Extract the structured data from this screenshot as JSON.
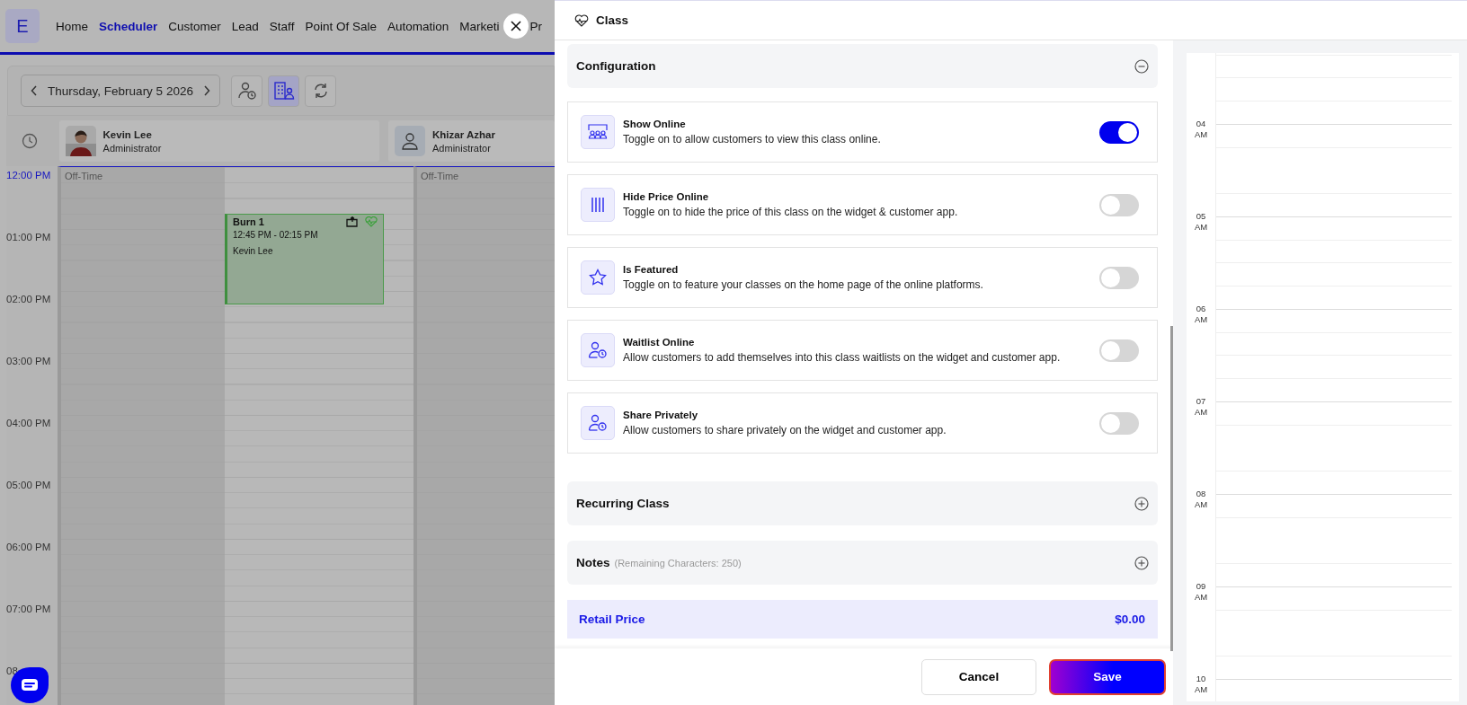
{
  "nav": {
    "logo": "E",
    "items": [
      {
        "label": "Home",
        "selected": false
      },
      {
        "label": "Scheduler",
        "selected": true
      },
      {
        "label": "Customer",
        "selected": false
      },
      {
        "label": "Lead",
        "selected": false
      },
      {
        "label": "Staff",
        "selected": false
      },
      {
        "label": "Point Of Sale",
        "selected": false
      },
      {
        "label": "Automation",
        "selected": false
      },
      {
        "label": "Marketi",
        "selected": false
      },
      {
        "label": "Pr",
        "selected": false
      }
    ]
  },
  "toolbar": {
    "date": "Thursday, February 5 2026",
    "view_buttons": [
      {
        "kind": "staff-schedule",
        "selected": false
      },
      {
        "kind": "room",
        "selected": true
      },
      {
        "kind": "refresh",
        "selected": false
      }
    ]
  },
  "times": [
    {
      "label": "12:00 PM",
      "current": true
    },
    {
      "label": "01:00 PM",
      "current": false
    },
    {
      "label": "02:00 PM",
      "current": false
    },
    {
      "label": "03:00 PM",
      "current": false
    },
    {
      "label": "04:00 PM",
      "current": false
    },
    {
      "label": "05:00 PM",
      "current": false
    },
    {
      "label": "06:00 PM",
      "current": false
    },
    {
      "label": "07:00 PM",
      "current": false
    },
    {
      "label": "08",
      "current": false
    }
  ],
  "staff": [
    {
      "name": "Kevin Lee",
      "role": "Administrator",
      "off_time": "Off-Time",
      "events": [
        {
          "title": "Burn 1",
          "time": "12:45 PM - 02:15 PM",
          "staff": "Kevin Lee"
        }
      ]
    },
    {
      "name": "Khizar Azhar",
      "role": "Administrator",
      "kind": "placeholder",
      "off_time": "Off-Time"
    }
  ],
  "panel": {
    "title": "Class",
    "configuration": {
      "title": "Configuration",
      "expanded": true,
      "options": [
        {
          "kind": "online",
          "title": "Show Online",
          "description": "Toggle on to allow customers to view this class online.",
          "on": true
        },
        {
          "kind": "price",
          "title": "Hide Price Online",
          "description": "Toggle on to hide the price of this class on the widget & customer app.",
          "on": false
        },
        {
          "kind": "star",
          "title": "Is Featured",
          "description": "Toggle on to feature your classes on the home page of the online platforms.",
          "on": false
        },
        {
          "kind": "waitlist",
          "title": "Waitlist Online",
          "description": "Allow customers to add themselves into this class waitlists on the widget and customer app.",
          "on": false
        },
        {
          "kind": "waitlist",
          "title": "Share Privately",
          "description": "Allow customers to share privately on the widget and customer app.",
          "on": false
        }
      ]
    },
    "sections": [
      {
        "title": "Recurring Class",
        "expanded": false
      },
      {
        "title": "Notes",
        "hint": "(Remaining Characters: 250)",
        "expanded": false
      }
    ],
    "retail": {
      "label": "Retail Price",
      "value": "$0.00"
    },
    "buttons": {
      "cancel": "Cancel",
      "save": "Save"
    }
  },
  "mini_calendar": {
    "hours": [
      "04 AM",
      "05 AM",
      "06 AM",
      "07 AM",
      "08 AM",
      "09 AM",
      "10 AM"
    ]
  }
}
